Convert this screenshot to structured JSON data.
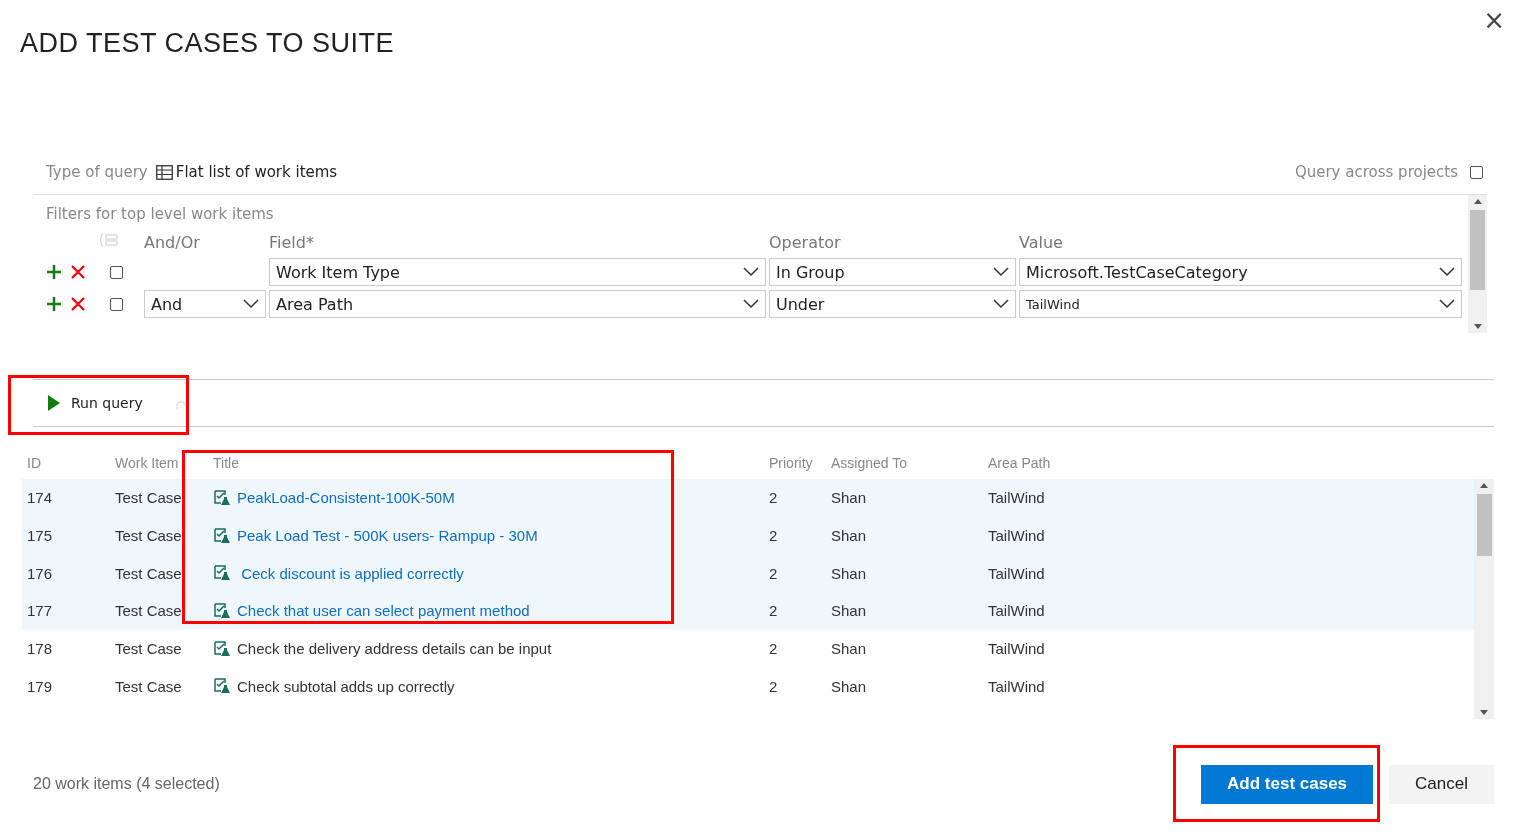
{
  "dialog": {
    "title": "ADD TEST CASES TO SUITE",
    "close": "×"
  },
  "query": {
    "type_label": "Type of query",
    "type_value": "Flat list of work items",
    "across_label": "Query across projects",
    "across_checked": false
  },
  "filters": {
    "heading": "Filters for top level work items",
    "columns": [
      "And/Or",
      "Field*",
      "Operator",
      "Value"
    ],
    "rows": [
      {
        "checked": false,
        "and_or": "",
        "field": "Work Item Type",
        "operator": "In Group",
        "value": "Microsoft.TestCaseCategory",
        "small_value": false
      },
      {
        "checked": false,
        "and_or": "And",
        "field": "Area Path",
        "operator": "Under",
        "value": "TailWind",
        "small_value": true
      }
    ]
  },
  "toolbar": {
    "run_label": "Run query",
    "highlighted": true
  },
  "table": {
    "columns": [
      "ID",
      "Work Item",
      "Title",
      "Priority",
      "Assigned To",
      "Area Path"
    ],
    "highlighted_selection": true,
    "rows": [
      {
        "id": "174",
        "type": "Test Case",
        "title": "PeakLoad-Consistent-100K-50M",
        "priority": "2",
        "assigned": "Shan",
        "area": "TailWind",
        "selected": true
      },
      {
        "id": "175",
        "type": "Test Case",
        "title": "Peak Load Test - 500K users- Rampup - 30M",
        "priority": "2",
        "assigned": "Shan",
        "area": "TailWind",
        "selected": true
      },
      {
        "id": "176",
        "type": "Test Case",
        "title": " Ceck discount is applied correctly",
        "priority": "2",
        "assigned": "Shan",
        "area": "TailWind",
        "selected": true
      },
      {
        "id": "177",
        "type": "Test Case",
        "title": "Check that user can select payment method",
        "priority": "2",
        "assigned": "Shan",
        "area": "TailWind",
        "selected": true
      },
      {
        "id": "178",
        "type": "Test Case",
        "title": "Check the delivery address details can be input",
        "priority": "2",
        "assigned": "Shan",
        "area": "TailWind",
        "selected": false
      },
      {
        "id": "179",
        "type": "Test Case",
        "title": "Check subtotal adds up correctly",
        "priority": "2",
        "assigned": "Shan",
        "area": "TailWind",
        "selected": false
      }
    ]
  },
  "footer": {
    "status": "20 work items (4 selected)",
    "primary": "Add test cases",
    "primary_highlighted": true,
    "cancel": "Cancel"
  }
}
